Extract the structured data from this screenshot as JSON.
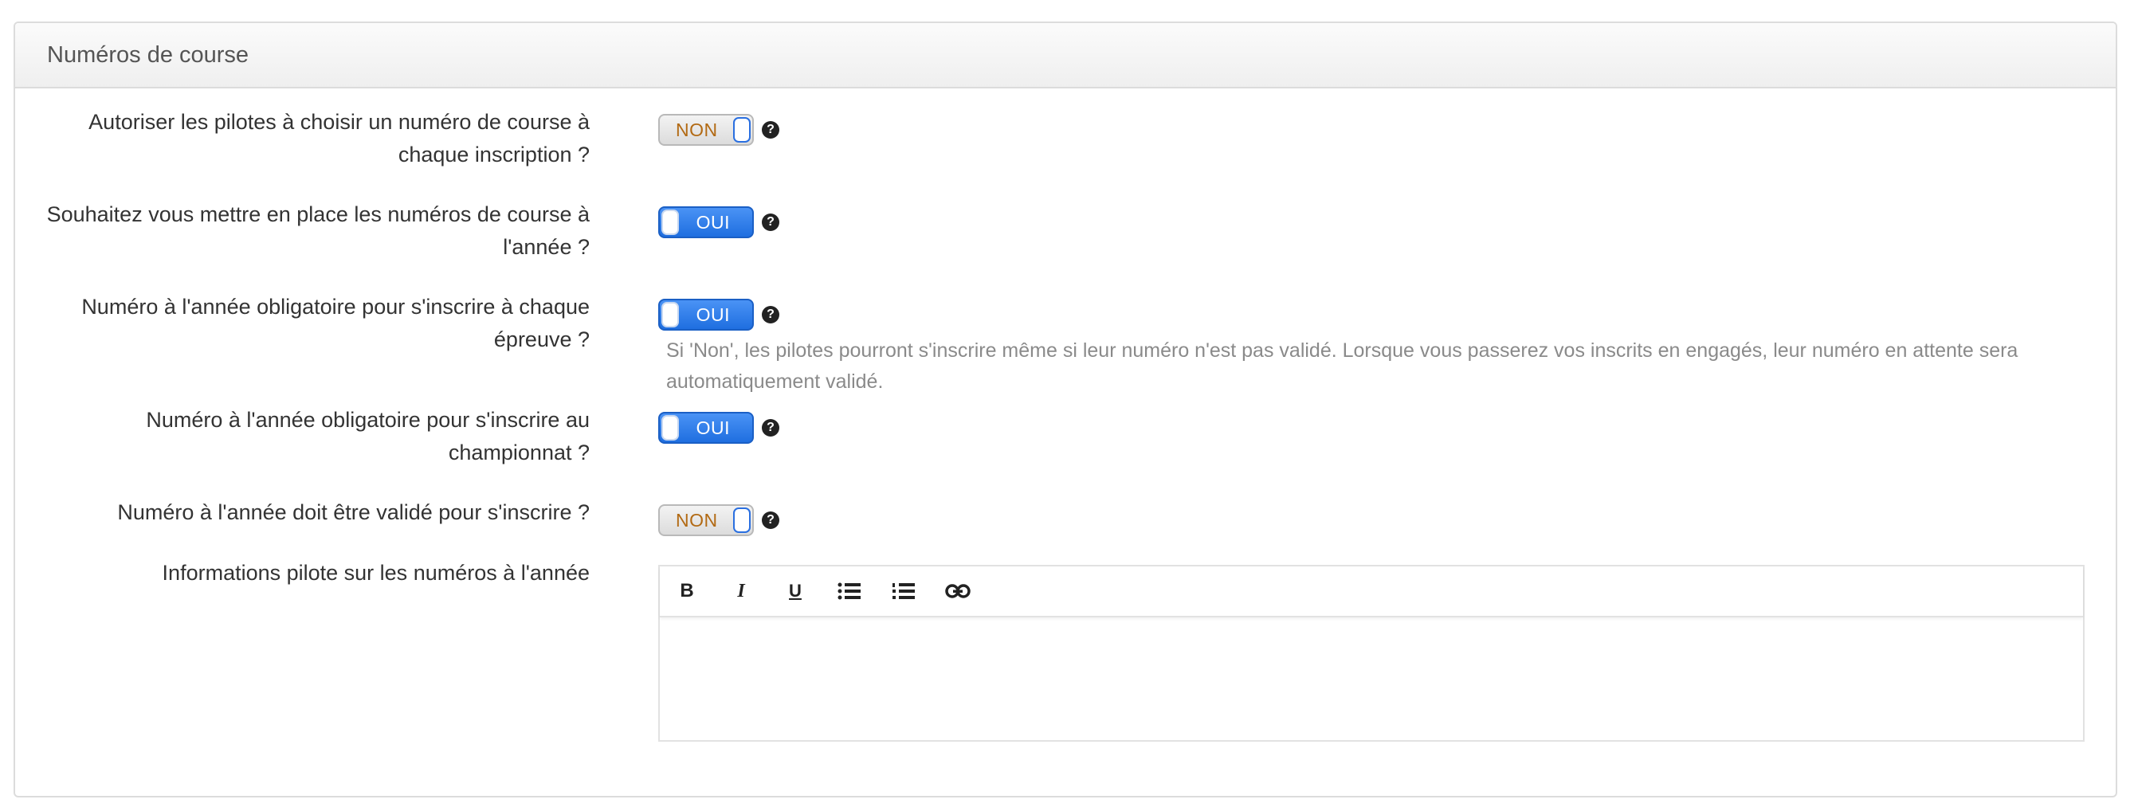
{
  "panel": {
    "title": "Numéros de course"
  },
  "rows": [
    {
      "label": "Autoriser les pilotes à choisir un numéro de course à chaque inscription ?",
      "toggle": "NON",
      "help": "?"
    },
    {
      "label": "Souhaitez vous mettre en place les numéros de course à l'année ?",
      "toggle": "OUI",
      "help": "?"
    },
    {
      "label": "Numéro à l'année obligatoire pour s'inscrire à chaque épreuve ?",
      "toggle": "OUI",
      "help": "?",
      "help_text": "Si 'Non', les pilotes pourront s'inscrire même si leur numéro n'est pas validé. Lorsque vous passerez vos inscrits en engagés, leur numéro en attente sera automatiquement validé."
    },
    {
      "label": "Numéro à l'année obligatoire pour s'inscrire au championnat ?",
      "toggle": "OUI",
      "help": "?"
    },
    {
      "label": "Numéro à l'année doit être validé pour s'inscrire ?",
      "toggle": "NON",
      "help": "?"
    }
  ],
  "editor": {
    "label": "Informations pilote sur les numéros à l'année",
    "toolbar": {
      "bold": "B",
      "italic": "I",
      "underline": "U"
    },
    "content": ""
  },
  "icons": {
    "help": "question-circle-icon",
    "bullet_list": "bullet-list-icon",
    "numbered_list": "numbered-list-icon",
    "link": "link-icon"
  },
  "colors": {
    "toggle_on": "#1f6fe0",
    "toggle_off_text": "#b26a14",
    "help_text": "#8a8a8a"
  }
}
